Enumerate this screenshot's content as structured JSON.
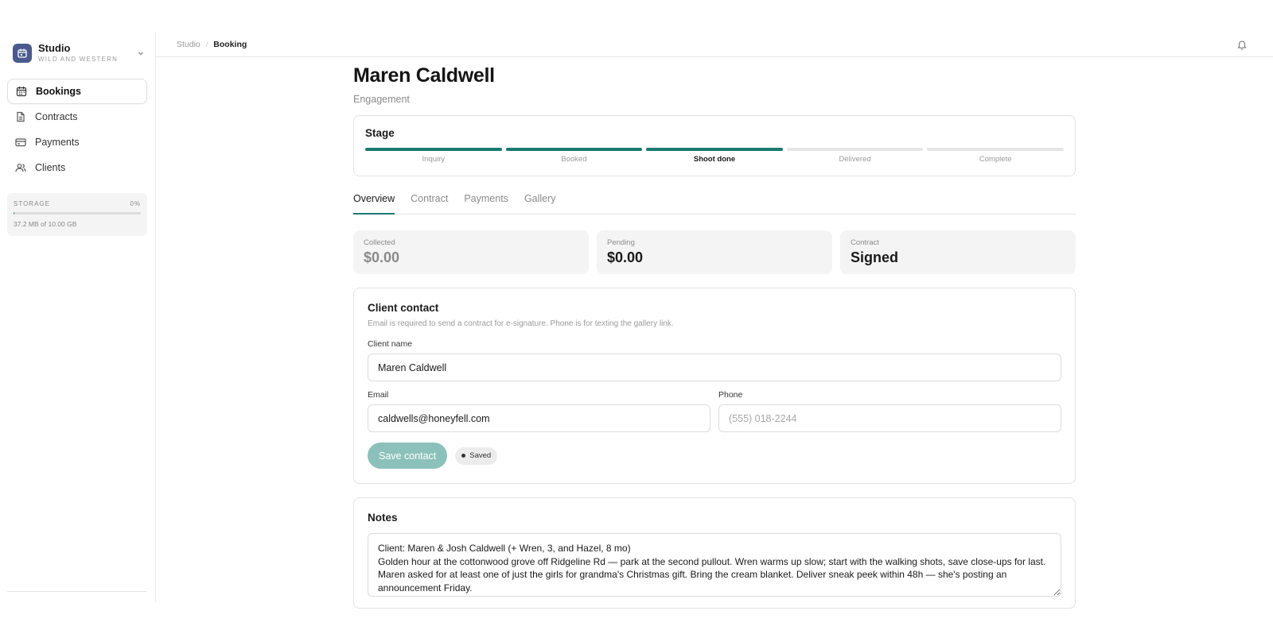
{
  "workspace": {
    "name": "Studio",
    "subtitle": "WILD AND WESTERN"
  },
  "nav": {
    "items": [
      {
        "label": "Bookings",
        "icon": "calendar-icon",
        "active": true
      },
      {
        "label": "Contracts",
        "icon": "document-icon",
        "active": false
      },
      {
        "label": "Payments",
        "icon": "credit-card-icon",
        "active": false
      },
      {
        "label": "Clients",
        "icon": "users-icon",
        "active": false
      }
    ]
  },
  "storage": {
    "label": "STORAGE",
    "percent_text": "0%",
    "usage_text": "37.2 MB of 10.00 GB",
    "fraction": 0.0036
  },
  "breadcrumb": {
    "parent": "Studio",
    "current": "Booking"
  },
  "booking": {
    "name": "Maren Caldwell",
    "type": "Engagement"
  },
  "stage": {
    "title": "Stage",
    "steps": [
      {
        "label": "Inquiry",
        "done": true,
        "current": false
      },
      {
        "label": "Booked",
        "done": true,
        "current": false
      },
      {
        "label": "Shoot done",
        "done": true,
        "current": true
      },
      {
        "label": "Delivered",
        "done": false,
        "current": false
      },
      {
        "label": "Complete",
        "done": false,
        "current": false
      }
    ]
  },
  "tabs": [
    {
      "label": "Overview",
      "active": true
    },
    {
      "label": "Contract",
      "active": false
    },
    {
      "label": "Payments",
      "active": false
    },
    {
      "label": "Gallery",
      "active": false
    }
  ],
  "stats": {
    "collected": {
      "label": "Collected",
      "value": "$0.00"
    },
    "pending": {
      "label": "Pending",
      "value": "$0.00"
    },
    "contract": {
      "label": "Contract",
      "value": "Signed"
    }
  },
  "contact": {
    "title": "Client contact",
    "description": "Email is required to send a contract for e-signature. Phone is for texting the gallery link.",
    "name_label": "Client name",
    "name_value": "Maren Caldwell",
    "email_label": "Email",
    "email_value": "caldwells@honeyfell.com",
    "phone_label": "Phone",
    "phone_placeholder": "(555) 018-2244",
    "save_label": "Save contact",
    "status": "Saved"
  },
  "notes": {
    "title": "Notes",
    "text": "Client: Maren & Josh Caldwell (+ Wren, 3, and Hazel, 8 mo)\nGolden hour at the cottonwood grove off Ridgeline Rd — park at the second pullout. Wren warms up slow; start with the walking shots, save close-ups for last. Maren asked for at least one of just the girls for grandma's Christmas gift. Bring the cream blanket. Deliver sneak peek within 48h — she's posting an announcement Friday."
  },
  "colors": {
    "accent": "#1a7a72",
    "logo": "#4a5a8c",
    "button_disabled": "#8cc1bb"
  }
}
